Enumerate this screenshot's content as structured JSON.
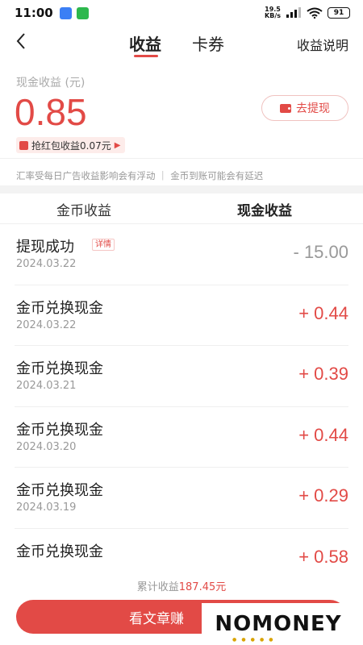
{
  "status_bar": {
    "time": "11:00",
    "net_speed_value": "19.5",
    "net_speed_unit": "KB/s",
    "battery": "91"
  },
  "header": {
    "tab_earnings": "收益",
    "tab_coupons": "卡券",
    "help": "收益说明"
  },
  "summary": {
    "cash_label": "现金收益 (元)",
    "cash_value": "0.85",
    "withdraw_label": "去提现",
    "redpacket_text": "抢红包收益0.07元",
    "note": "汇率受每日广告收益影响会有浮动 ｜ 金币到账可能会有延迟"
  },
  "subtabs": {
    "coin": "金币收益",
    "cash": "现金收益"
  },
  "records": [
    {
      "title": "提现成功",
      "tag": "详情",
      "date": "2024.03.22",
      "amount": "- 15.00",
      "negative": true
    },
    {
      "title": "金币兑换现金",
      "date": "2024.03.22",
      "amount": "+ 0.44"
    },
    {
      "title": "金币兑换现金",
      "date": "2024.03.21",
      "amount": "+ 0.39"
    },
    {
      "title": "金币兑换现金",
      "date": "2024.03.20",
      "amount": "+ 0.44"
    },
    {
      "title": "金币兑换现金",
      "date": "2024.03.19",
      "amount": "+ 0.29"
    },
    {
      "title": "金币兑换现金",
      "date": "",
      "amount": "+ 0.58"
    }
  ],
  "footer": {
    "cumulative_label": "累计收益",
    "cumulative_value": "187.45元",
    "main_button": "看文章赚"
  },
  "watermark": "NOMONEY",
  "colors": {
    "accent": "#e24a46"
  }
}
